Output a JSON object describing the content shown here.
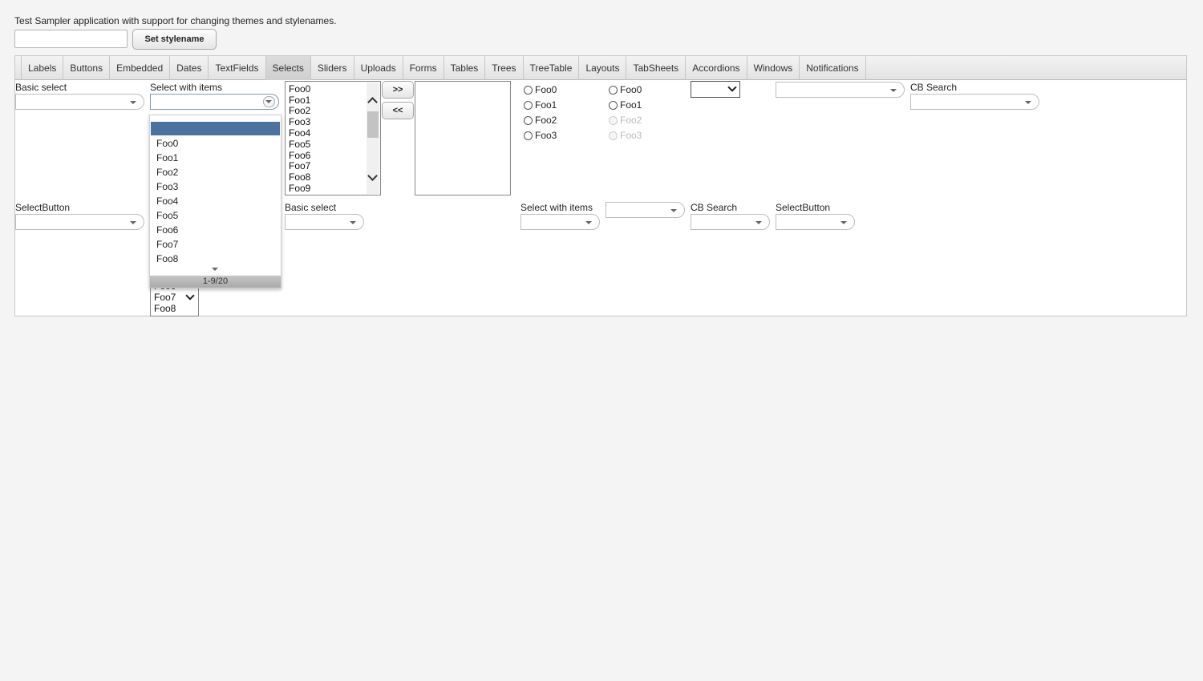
{
  "header": {
    "description": "Test Sampler application with support for changing themes and stylenames.",
    "stylename_value": "",
    "set_stylename_label": "Set stylename"
  },
  "tabs": [
    "Labels",
    "Buttons",
    "Embedded",
    "Dates",
    "TextFields",
    "Selects",
    "Sliders",
    "Uploads",
    "Forms",
    "Tables",
    "Trees",
    "TreeTable",
    "Layouts",
    "TabSheets",
    "Accordions",
    "Windows",
    "Notifications"
  ],
  "selected_tab": "Selects",
  "row1": {
    "basic_select_caption": "Basic select",
    "select_with_items_caption": "Select with items",
    "cb_search_caption": "CB Search"
  },
  "popup": {
    "items": [
      "Foo0",
      "Foo1",
      "Foo2",
      "Foo3",
      "Foo4",
      "Foo5",
      "Foo6",
      "Foo7",
      "Foo8"
    ],
    "status": "1-9/20"
  },
  "listbox": {
    "items": [
      "Foo0",
      "Foo1",
      "Foo2",
      "Foo3",
      "Foo4",
      "Foo5",
      "Foo6",
      "Foo7",
      "Foo8",
      "Foo9"
    ]
  },
  "twincol": {
    "add_label": ">>",
    "remove_label": "<<"
  },
  "option_groups": {
    "group1": [
      "Foo0",
      "Foo1",
      "Foo2",
      "Foo3"
    ],
    "group2": [
      "Foo0",
      "Foo1",
      "Foo2",
      "Foo3"
    ]
  },
  "row2": {
    "selectbutton_caption": "SelectButton",
    "basic_select_caption": "Basic select",
    "select_with_items_caption": "Select with items",
    "cb_search_caption": "CB Search",
    "selectbutton2_caption": "SelectButton"
  },
  "small_list": {
    "items": [
      "Foo6",
      "Foo7",
      "Foo8"
    ]
  }
}
